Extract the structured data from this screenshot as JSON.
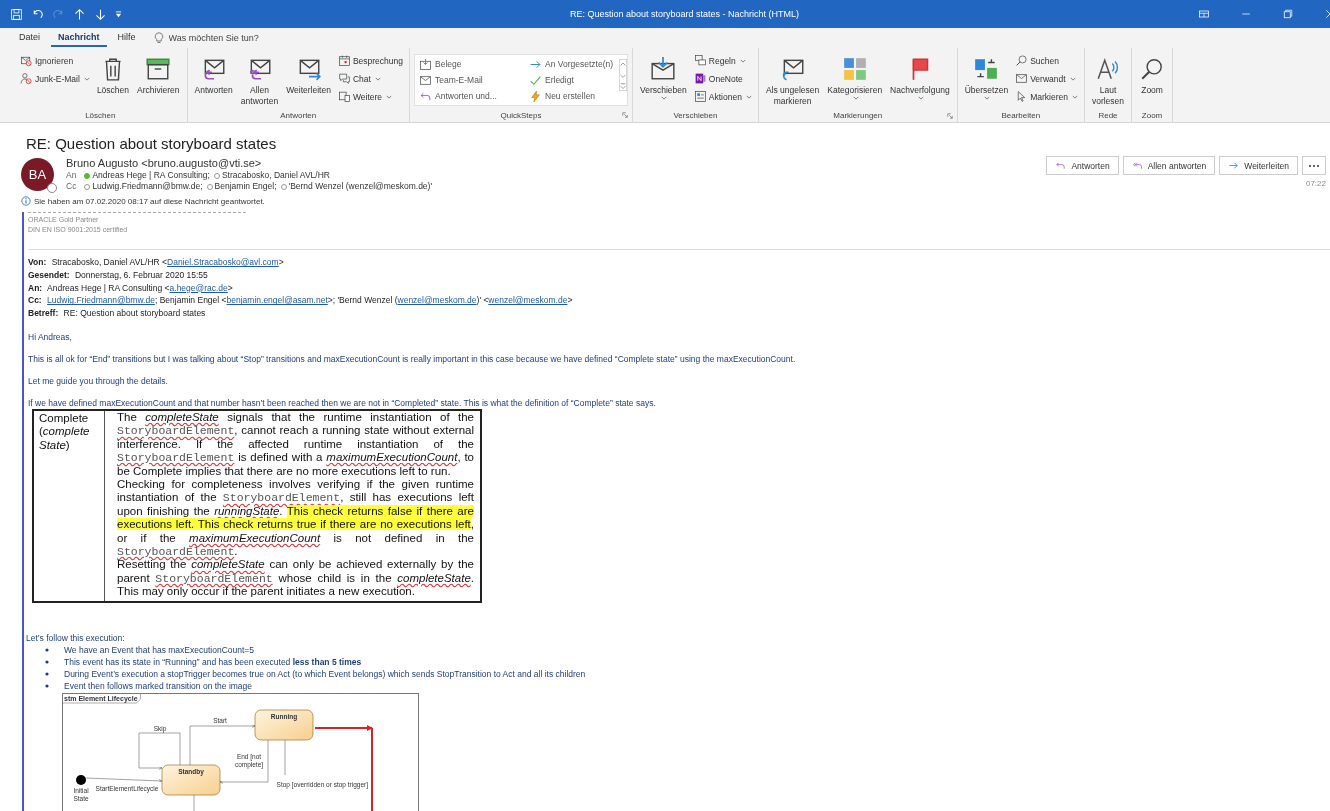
{
  "window": {
    "title": "RE: Question about storyboard states  -  Nachricht (HTML)"
  },
  "menu_tabs": [
    {
      "label": "Datei",
      "selected": false
    },
    {
      "label": "Nachricht",
      "selected": true
    },
    {
      "label": "Hilfe",
      "selected": false
    }
  ],
  "tell_me": {
    "placeholder": "Was möchten Sie tun?"
  },
  "ribbon": {
    "groups": [
      {
        "label": "Löschen",
        "launcher": false,
        "controls": [
          {
            "kind": "stack",
            "items": [
              {
                "label": "Ignorieren",
                "menu": false
              },
              {
                "label": "Junk-E-Mail",
                "menu": true
              }
            ]
          },
          {
            "kind": "large",
            "lines": [
              "Löschen"
            ],
            "menu": false
          },
          {
            "kind": "large",
            "lines": [
              "Archivieren"
            ],
            "menu": false
          }
        ]
      },
      {
        "label": "Antworten",
        "launcher": false,
        "controls": [
          {
            "kind": "large",
            "lines": [
              "Antworten"
            ],
            "menu": false
          },
          {
            "kind": "large",
            "lines": [
              "Allen",
              "antworten"
            ],
            "menu": false
          },
          {
            "kind": "large",
            "lines": [
              "Weiterleiten"
            ],
            "menu": false
          },
          {
            "kind": "stack",
            "items": [
              {
                "label": "Besprechung",
                "menu": false
              },
              {
                "label": "Chat",
                "menu": true
              },
              {
                "label": "Weitere",
                "menu": true
              }
            ]
          }
        ]
      },
      {
        "label": "QuickSteps",
        "launcher": true,
        "controls": [
          {
            "kind": "gallery",
            "items": [
              {
                "label": "Belege"
              },
              {
                "label": "Team-E-Mail"
              },
              {
                "label": "Antworten und..."
              },
              {
                "label": "An Vorgesetzte(n)"
              },
              {
                "label": "Erledigt"
              },
              {
                "label": "Neu erstellen"
              }
            ]
          }
        ]
      },
      {
        "label": "Verschieben",
        "launcher": false,
        "controls": [
          {
            "kind": "large",
            "lines": [
              "Verschieben"
            ],
            "menu": true
          },
          {
            "kind": "stack",
            "items": [
              {
                "label": "Regeln",
                "menu": true
              },
              {
                "label": "OneNote",
                "menu": false
              },
              {
                "label": "Aktionen",
                "menu": true
              }
            ]
          }
        ]
      },
      {
        "label": "Markierungen",
        "launcher": true,
        "controls": [
          {
            "kind": "large",
            "lines": [
              "Als ungelesen",
              "markieren"
            ],
            "menu": false
          },
          {
            "kind": "large",
            "lines": [
              "Kategorisieren"
            ],
            "menu": true
          },
          {
            "kind": "large",
            "lines": [
              "Nachverfolgung"
            ],
            "menu": true
          }
        ]
      },
      {
        "label": "Bearbeiten",
        "launcher": false,
        "controls": [
          {
            "kind": "large",
            "lines": [
              "Übersetzen"
            ],
            "menu": true
          },
          {
            "kind": "stack",
            "items": [
              {
                "label": "Suchen",
                "menu": false
              },
              {
                "label": "Verwandt",
                "menu": true
              },
              {
                "label": "Markieren",
                "menu": true
              }
            ]
          }
        ]
      },
      {
        "label": "Rede",
        "launcher": false,
        "controls": [
          {
            "kind": "large",
            "lines": [
              "Laut",
              "vorlesen"
            ],
            "menu": false
          }
        ]
      },
      {
        "label": "Zoom",
        "launcher": false,
        "controls": [
          {
            "kind": "large",
            "lines": [
              "Zoom"
            ],
            "menu": false
          }
        ]
      }
    ]
  },
  "message": {
    "subject": "RE: Question about storyboard states",
    "avatar": "BA",
    "sender": "Bruno Augusto <bruno.augusto@vti.se>",
    "to_label": "An",
    "to": [
      {
        "name": "Andreas Hege | RA Consulting;",
        "available": true
      },
      {
        "name": "Stracabosko, Daniel AVL/HR",
        "available": false
      }
    ],
    "cc_label": "Cc",
    "cc": [
      {
        "name": "Ludwig.Friedmann@bmw.de;",
        "available": false
      },
      {
        "name": "Benjamin Engel;",
        "available": false
      },
      {
        "name": "'Bernd Wenzel (wenzel@meskom.de)'",
        "available": false
      }
    ],
    "info": "Sie haben am 07.02.2020 08:17 auf diese Nachricht geantwortet.",
    "actions": [
      {
        "label": "Antworten"
      },
      {
        "label": "Allen antworten"
      },
      {
        "label": "Weiterleiten"
      }
    ],
    "time": "07:22"
  },
  "body": {
    "signature": [
      "ORACLE Gold Partner",
      "DIN EN ISO 9001:2015 certified"
    ],
    "quoted_header": [
      {
        "label": "Von:",
        "parts": [
          {
            "text": "Stracabosko, Daniel AVL/HR <",
            "link": false
          },
          {
            "text": "Daniel.Stracabosko@avl.com",
            "link": true
          },
          {
            "text": ">",
            "link": false
          }
        ]
      },
      {
        "label": "Gesendet:",
        "parts": [
          {
            "text": "Donnerstag, 6. Februar 2020 15:55",
            "link": false
          }
        ]
      },
      {
        "label": "An:",
        "parts": [
          {
            "text": "Andreas Hege | RA Consulting <",
            "link": false
          },
          {
            "text": "a.hege@rac.de",
            "link": true
          },
          {
            "text": ">",
            "link": false
          }
        ]
      },
      {
        "label": "Cc:",
        "parts": [
          {
            "text": "Ludwig.Friedmann@bmw.de",
            "link": true
          },
          {
            "text": "; Benjamin Engel <",
            "link": false
          },
          {
            "text": "benjamin.engel@asam.net",
            "link": true
          },
          {
            "text": ">; 'Bernd Wenzel (",
            "link": false
          },
          {
            "text": "wenzel@meskom.de",
            "link": true
          },
          {
            "text": ")' <",
            "link": false
          },
          {
            "text": "wenzel@meskom.de",
            "link": true
          },
          {
            "text": ">",
            "link": false
          }
        ]
      },
      {
        "label": "Betreff:",
        "parts": [
          {
            "text": "RE: Question about storyboard states",
            "link": false
          }
        ]
      }
    ],
    "paragraphs": [
      "Hi Andreas,",
      "This is all ok for “End” transitions but I was talking about “Stop” transitions and maxExecutionCount is really important in this case because we have defined “Complete state” using the maxExecutionCount.",
      "Let me guide you through the details.",
      "If we have defined maxExecutionCount and that number hasn’t been reached then we are not in “Completed” state. This is what the definition of “Complete” state says."
    ],
    "definition_table": {
      "term": "Complete (*complete State*)",
      "paragraphs": [
        [
          {
            "kind": "plain",
            "text": "The "
          },
          {
            "kind": "italic",
            "text": "completeState"
          },
          {
            "kind": "plain",
            "text": " signals that the runtime instantiation of the "
          },
          {
            "kind": "code",
            "text": "StoryboardElement"
          },
          {
            "kind": "plain",
            "text": ", cannot reach a running state without external interference. If the affected runtime instantiation of the "
          },
          {
            "kind": "code",
            "text": "StoryboardElement"
          },
          {
            "kind": "plain",
            "text": " is defined with a "
          },
          {
            "kind": "italic",
            "text": "maximumExecutionCount"
          },
          {
            "kind": "plain",
            "text": ", to be Complete implies that there are no more executions left to run."
          }
        ],
        [
          {
            "kind": "plain",
            "text": "Checking for completeness involves verifying if the given runtime instantiation of the "
          },
          {
            "kind": "code",
            "text": "StoryboardElement"
          },
          {
            "kind": "plain",
            "text": ", still has executions left upon finishing the "
          },
          {
            "kind": "italic",
            "text": "runningState"
          },
          {
            "kind": "plain",
            "text": ". "
          },
          {
            "kind": "highlight",
            "text": "This check returns false if there are executions left. This check returns true if there are no executions left"
          },
          {
            "kind": "plain",
            "text": ", or if the "
          },
          {
            "kind": "italic",
            "text": "maximumExecutionCount"
          },
          {
            "kind": "plain",
            "text": " is not defined in the "
          },
          {
            "kind": "code",
            "text": "StoryboardElement"
          },
          {
            "kind": "plain",
            "text": "."
          }
        ],
        [
          {
            "kind": "plain",
            "text": "Resetting the "
          },
          {
            "kind": "italic",
            "text": "completeState"
          },
          {
            "kind": "plain",
            "text": " can only be achieved externally by the parent "
          },
          {
            "kind": "code",
            "text": "StoryboardElement"
          },
          {
            "kind": "plain",
            "text": " whose child is in the "
          },
          {
            "kind": "italic",
            "text": "completeState"
          },
          {
            "kind": "plain",
            "text": ". This may only occur if the parent initiates a new execution."
          }
        ]
      ]
    },
    "list_intro": "Let’s follow this execution:",
    "bullets": [
      "We have an Event that has maxExecutionCount=5",
      "This event has its state in “Running” and has been executed **less than 5 times**",
      "During Event’s execution a stopTrigger becomes true on Act (to which Event belongs) which sends StopTransition to Act and all its children",
      "Event then follows marked transition on the image"
    ],
    "diagram": {
      "frame_title": "stm Element Lifecycle",
      "states": [
        {
          "label": "Running"
        },
        {
          "label": "Standby"
        }
      ],
      "initial_label": [
        "Initial",
        "State"
      ],
      "transitions": [
        {
          "lines": [
            "Start"
          ],
          "highlighted": false
        },
        {
          "lines": [
            "Skip"
          ],
          "highlighted": false
        },
        {
          "lines": [
            "End [not",
            "complete]"
          ],
          "highlighted": false
        },
        {
          "lines": [
            "StartElementLifecycle"
          ],
          "highlighted": false
        },
        {
          "lines": [
            "Stop [overridden or stop trigger]"
          ],
          "highlighted": true
        }
      ]
    }
  }
}
